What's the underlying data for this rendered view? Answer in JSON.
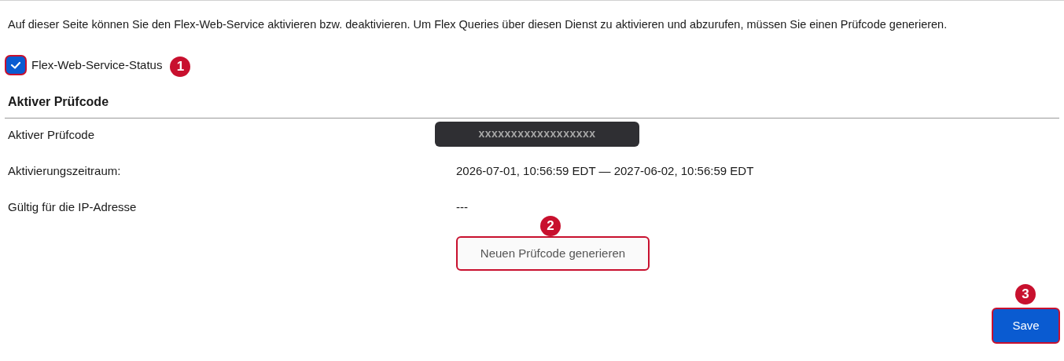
{
  "intro": "Auf dieser Seite können Sie den Flex-Web-Service aktivieren bzw. deaktivieren. Um Flex Queries über diesen Dienst zu aktivieren und abzurufen, müssen Sie einen Prüfcode generieren.",
  "status_checkbox": {
    "label": "Flex-Web-Service-Status",
    "checked": true,
    "highlighted": true,
    "callout": "1"
  },
  "section_title": "Aktiver Prüfcode",
  "rows": [
    {
      "kind": "masked",
      "label": "Aktiver Prüfcode",
      "value": "xxxxxxxxxxxxxxxxxx"
    },
    {
      "kind": "text",
      "label": "Aktivierungszeitraum:",
      "value": "2026-07-01, 10:56:59 EDT — 2027-06-02, 10:56:59 EDT"
    },
    {
      "kind": "text",
      "label": "Gültig für die IP-Adresse",
      "value": "---"
    }
  ],
  "generate_button": {
    "label": "Neuen Prüfcode generieren",
    "highlighted": true,
    "callout": "2"
  },
  "save_button": {
    "label": "Save",
    "highlighted": true,
    "callout": "3"
  }
}
